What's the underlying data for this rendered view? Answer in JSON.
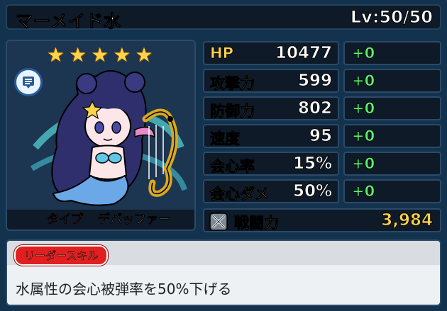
{
  "character": {
    "name": "マーメイド水",
    "level": "Lv:50/50",
    "rarity_stars": 5,
    "type_label": "タイプ",
    "type_value": "デバッファー"
  },
  "stats": [
    {
      "label": "HP",
      "value": "10477",
      "bonus": "+0"
    },
    {
      "label": "攻撃力",
      "value": "599",
      "bonus": "+0"
    },
    {
      "label": "防御力",
      "value": "802",
      "bonus": "+0"
    },
    {
      "label": "速度",
      "value": "95",
      "bonus": "+0"
    },
    {
      "label": "会心率",
      "value": "15%",
      "bonus": "+0"
    },
    {
      "label": "会心ダメ",
      "value": "50%",
      "bonus": "+0"
    }
  ],
  "power": {
    "label": "戦闘力",
    "value": "3,984"
  },
  "leader_skill": {
    "tag": "リーダースキル",
    "description": "水属性の会心被弾率を50%下げる"
  },
  "icons": {
    "memo": "memo-bubble-icon",
    "power": "crossed-swords-icon",
    "star": "star-icon"
  },
  "colors": {
    "stat_label": "#ffd34a",
    "bonus": "#5cf06a",
    "type_label": "#ff3b3b",
    "skill_tag": "#e02020"
  }
}
